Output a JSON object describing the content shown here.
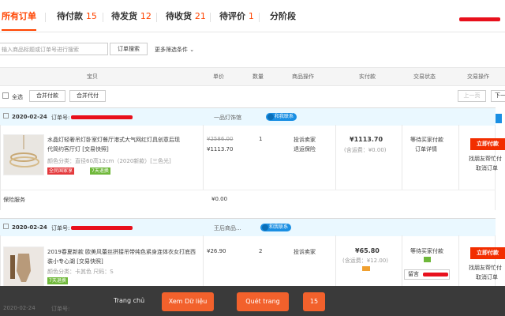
{
  "tabs": [
    {
      "label": "所有订单",
      "count": ""
    },
    {
      "label": "待付款",
      "count": "15"
    },
    {
      "label": "待发货",
      "count": "12"
    },
    {
      "label": "待收货",
      "count": "21"
    },
    {
      "label": "待评价",
      "count": "1"
    },
    {
      "label": "分阶段",
      "count": ""
    }
  ],
  "search": {
    "placeholder": "输入商品标题或订单号进行搜索",
    "button": "订单搜索",
    "more_filters": "更多筛选条件"
  },
  "columns": {
    "item": "宝贝",
    "price": "单价",
    "qty": "数量",
    "ops": "商品操作",
    "paid": "实付款",
    "status": "交易状态",
    "actions": "交易操作"
  },
  "bulk": {
    "select_all": "全选",
    "merge_pay": "合并付款",
    "merge_proxy": "合并代付",
    "prev": "上一页",
    "next": "下一"
  },
  "orders": [
    {
      "date": "2020-02-24",
      "order_label": "订单号:",
      "shop": "一品灯饰馆",
      "chat": "和我联系",
      "title_lines": [
        "水晶灯轻奢吊灯卧室灯餐厅港式大气网红灯具创意后现",
        "代简约客厅灯 [交易快照]"
      ],
      "spec": "颜色分类：直径60高12cm（2020新款）[三色光]",
      "badges": [
        "全民国家享",
        "7天退换"
      ],
      "orig_price": "¥2586.00",
      "price": "¥1113.70",
      "qty": "1",
      "ops": [
        "投诉卖家",
        "退运保险"
      ],
      "total": "¥1113.70",
      "shipping": "(含运费：¥0.00)",
      "status": [
        "等待买家付款",
        "订单详情"
      ],
      "pay_button": "立即付款",
      "actions": [
        "找朋友帮忙付",
        "取消订单"
      ],
      "service_label": "保险服务",
      "service_price": "¥0.00"
    },
    {
      "date": "2020-02-24",
      "order_label": "订单号:",
      "shop": "王后商品...",
      "chat": "和我联系",
      "title_lines": [
        "2019春夏新款 欧美风蕾丝拼接吊带纯色紧身连体衣女打底西",
        "装小专心湖 [交易快照]"
      ],
      "spec": "颜色分类：卡其色  尺码：S",
      "badges": [
        "7天退换"
      ],
      "price": "¥26.90",
      "qty": "2",
      "ops": [
        "投诉卖家"
      ],
      "total": "¥65.80",
      "shipping": "(含运费：¥12.00)",
      "status": [
        "等待买家付款",
        "留言"
      ],
      "pay_button": "立即付款",
      "actions": [
        "找朋友帮忙付",
        "取消订单"
      ]
    },
    {
      "date": "2020-02-24",
      "order_label": "订单号:"
    }
  ],
  "bottom_bar": {
    "home": "Trang chủ",
    "view_data": "Xem Dữ liệu",
    "scan": "Quét trang",
    "page": "15"
  },
  "colors": {
    "accent": "#f40",
    "pay": "#f22e00",
    "bar": "#3a3a3a",
    "button": "#f2612c",
    "order_head": "#eaf8ff"
  }
}
